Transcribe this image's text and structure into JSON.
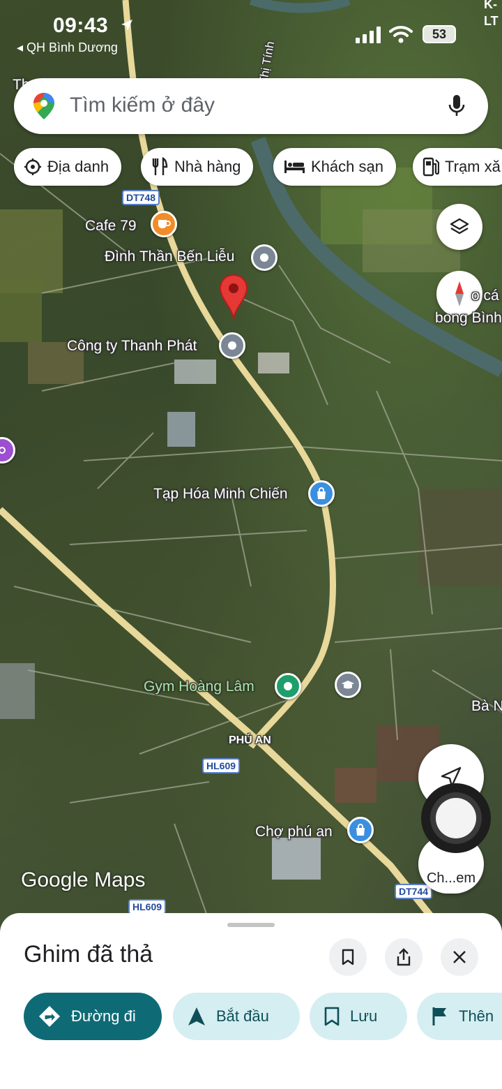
{
  "status_bar": {
    "time": "09:43",
    "back_app": "◂ QH Bình Dương",
    "carrier_line1": "K-",
    "carrier_line2": "LT",
    "battery": "53"
  },
  "search": {
    "placeholder": "Tìm kiếm ở đây"
  },
  "chips": [
    {
      "label": "Địa danh",
      "icon": "landmark-icon"
    },
    {
      "label": "Nhà hàng",
      "icon": "fork-knife-icon"
    },
    {
      "label": "Khách sạn",
      "icon": "bed-icon"
    },
    {
      "label": "Trạm xă",
      "icon": "fuel-icon"
    }
  ],
  "map_labels": {
    "cafe": "Cafe 79",
    "dinh_than": "Đình Thần Bến Liễu",
    "cong_ty": "Công ty Thanh Phát",
    "tap_hoa": "Tạp Hóa Minh Chiến",
    "gym": "Gym Hoàng Lâm",
    "phu_an": "PHÚ AN",
    "cho": "Chợ phú an",
    "thi_tinh": "Thị Tính",
    "bong_binh_1": "o cá",
    "bong_binh_2": "bong Bình",
    "ba_n": "Bà N",
    "top_left": "Th",
    "chem": "Ch...em"
  },
  "road_shields": [
    "DT748",
    "HL609",
    "HL609",
    "DT744"
  ],
  "watermark": {
    "google": "Google",
    "maps": "Maps"
  },
  "sheet": {
    "title": "Ghim đã thả",
    "actions": [
      {
        "label": "Đường đi",
        "icon": "directions-icon"
      },
      {
        "label": "Bắt đầu",
        "icon": "navigation-arrow-icon"
      },
      {
        "label": "Lưu",
        "icon": "bookmark-icon"
      },
      {
        "label": "Thên",
        "icon": "flag-icon"
      }
    ]
  },
  "colors": {
    "accent": "#0e6b76",
    "pin_red": "#e53935",
    "road": "#e8d89a"
  }
}
